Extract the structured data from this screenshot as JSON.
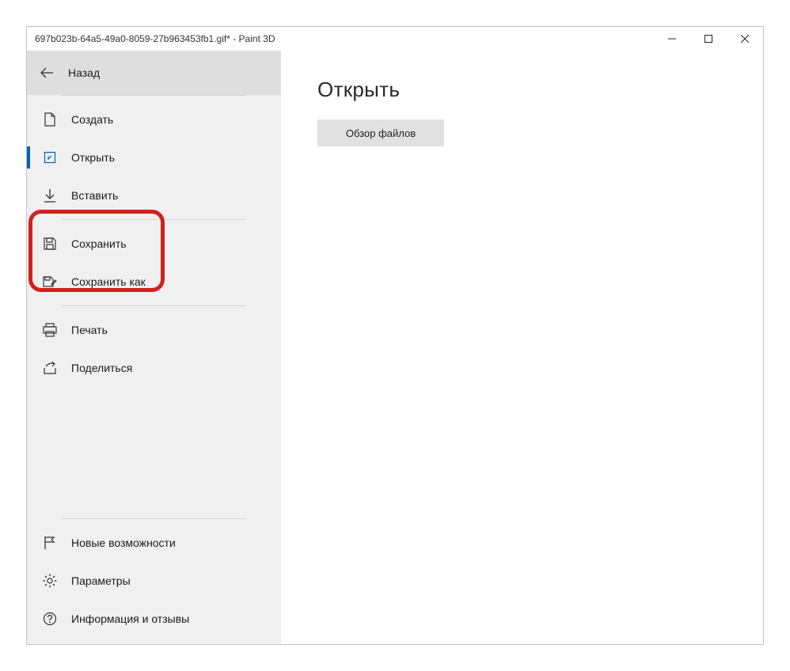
{
  "window": {
    "title": "697b023b-64a5-49a0-8059-27b963453fb1.gif* - Paint 3D"
  },
  "sidebar": {
    "back_label": "Назад",
    "items": [
      {
        "label": "Создать"
      },
      {
        "label": "Открыть"
      },
      {
        "label": "Вставить"
      },
      {
        "label": "Сохранить"
      },
      {
        "label": "Сохранить как"
      },
      {
        "label": "Печать"
      },
      {
        "label": "Поделиться"
      }
    ],
    "bottom_items": [
      {
        "label": "Новые возможности"
      },
      {
        "label": "Параметры"
      },
      {
        "label": "Информация и отзывы"
      }
    ]
  },
  "main": {
    "heading": "Открыть",
    "browse_button": "Обзор файлов"
  },
  "annotation": {
    "highlight_color": "#d2201f"
  }
}
